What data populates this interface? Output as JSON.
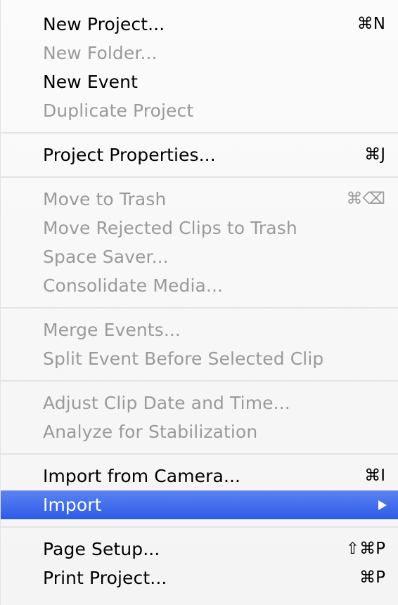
{
  "menu": {
    "items": [
      {
        "label": "New Project...",
        "shortcut": "⌘N"
      },
      {
        "label": "New Folder...",
        "shortcut": ""
      },
      {
        "label": "New Event",
        "shortcut": ""
      },
      {
        "label": "Duplicate Project",
        "shortcut": ""
      },
      {
        "label": "Project Properties...",
        "shortcut": "⌘J"
      },
      {
        "label": "Move to Trash",
        "shortcut": "⌘⌫"
      },
      {
        "label": "Move Rejected Clips to Trash",
        "shortcut": ""
      },
      {
        "label": "Space Saver...",
        "shortcut": ""
      },
      {
        "label": "Consolidate Media...",
        "shortcut": ""
      },
      {
        "label": "Merge Events...",
        "shortcut": ""
      },
      {
        "label": "Split Event Before Selected Clip",
        "shortcut": ""
      },
      {
        "label": "Adjust Clip Date and Time...",
        "shortcut": ""
      },
      {
        "label": "Analyze for Stabilization",
        "shortcut": ""
      },
      {
        "label": "Import from Camera...",
        "shortcut": "⌘I"
      },
      {
        "label": "Import",
        "shortcut": ""
      },
      {
        "label": "Page Setup...",
        "shortcut": "⇧⌘P"
      },
      {
        "label": "Print Project...",
        "shortcut": "⌘P"
      }
    ]
  },
  "colors": {
    "enabled_text": "#000000",
    "disabled_text": "#9a9a9a",
    "highlight": "#3a68ec",
    "separator": "#e3e3e3"
  },
  "icons": {
    "submenu": "submenu-arrow-icon"
  }
}
